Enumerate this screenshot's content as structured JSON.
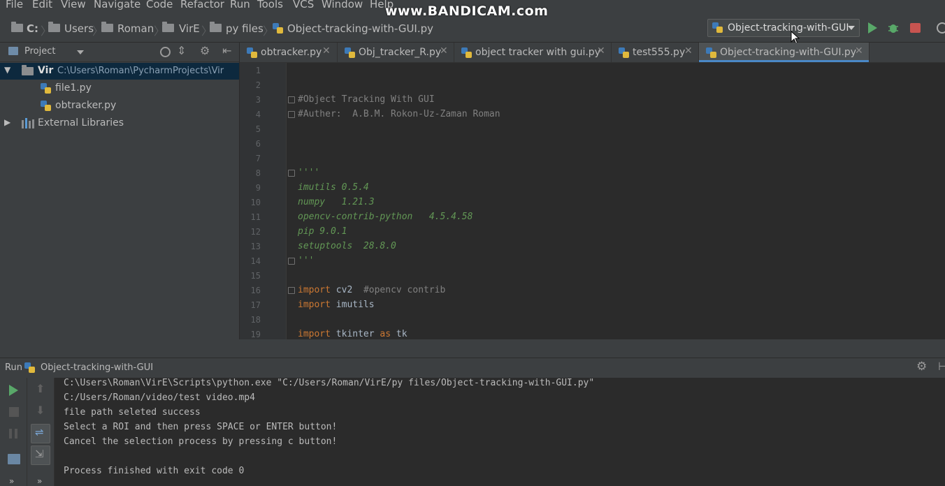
{
  "menu": [
    "File",
    "Edit",
    "View",
    "Navigate",
    "Code",
    "Refactor",
    "Run",
    "Tools",
    "VCS",
    "Window",
    "Help"
  ],
  "watermark": "www.BANDICAM.com",
  "breadcrumb": [
    "C:",
    "Users",
    "Roman",
    "VirE",
    "py files",
    "Object-tracking-with-GUI.py"
  ],
  "run_config": "Object-tracking-with-GUI",
  "project": {
    "header": "Project",
    "root_name": "Vir",
    "root_path": "C:\\Users\\Roman\\PycharmProjects\\Vir",
    "files": [
      "file1.py",
      "obtracker.py"
    ],
    "external": "External Libraries"
  },
  "tabs": [
    "obtracker.py",
    "Obj_tracker_R.py",
    "object tracker with gui.py",
    "test555.py",
    "Object-tracking-with-GUI.py"
  ],
  "active_tab_index": 4,
  "editor": {
    "line_numbers": [
      "1",
      "2",
      "3",
      "4",
      "5",
      "6",
      "7",
      "8",
      "9",
      "10",
      "11",
      "12",
      "13",
      "14",
      "15",
      "16",
      "17",
      "18",
      "19"
    ],
    "comment1": "#Object Tracking With GUI",
    "comment2": "#Auther:  A.B.M. Rokon-Uz-Zaman Roman",
    "doc_open": "''''",
    "doc_lines": [
      "imutils 0.5.4",
      "numpy   1.21.3",
      "opencv-contrib-python   4.5.4.58",
      "pip 9.0.1",
      "setuptools  28.8.0"
    ],
    "doc_close": "'''",
    "import1_kw": "import",
    "import1_mod": " cv2  ",
    "import1_cmt": "#opencv contrib",
    "import2_kw": "import",
    "import2_mod": " imutils",
    "import3_kw": "import",
    "import3_mod": " tkinter ",
    "import3_as": "as",
    "import3_alias": " tk"
  },
  "run_panel": {
    "label": "Run",
    "config": "Object-tracking-with-GUI",
    "output": [
      "C:\\Users\\Roman\\VirE\\Scripts\\python.exe \"C:/Users/Roman/VirE/py files/Object-tracking-with-GUI.py\"",
      "C:/Users/Roman/video/test video.mp4",
      "file path seleted success",
      "Select a ROI and then press SPACE or ENTER button!",
      "Cancel the selection process by pressing c button!",
      "",
      "Process finished with exit code 0"
    ]
  },
  "colors": {
    "accent": "#4a88c7",
    "run": "#59a869",
    "stop": "#c75450",
    "keyword": "#cc7832",
    "docstring": "#629755"
  }
}
